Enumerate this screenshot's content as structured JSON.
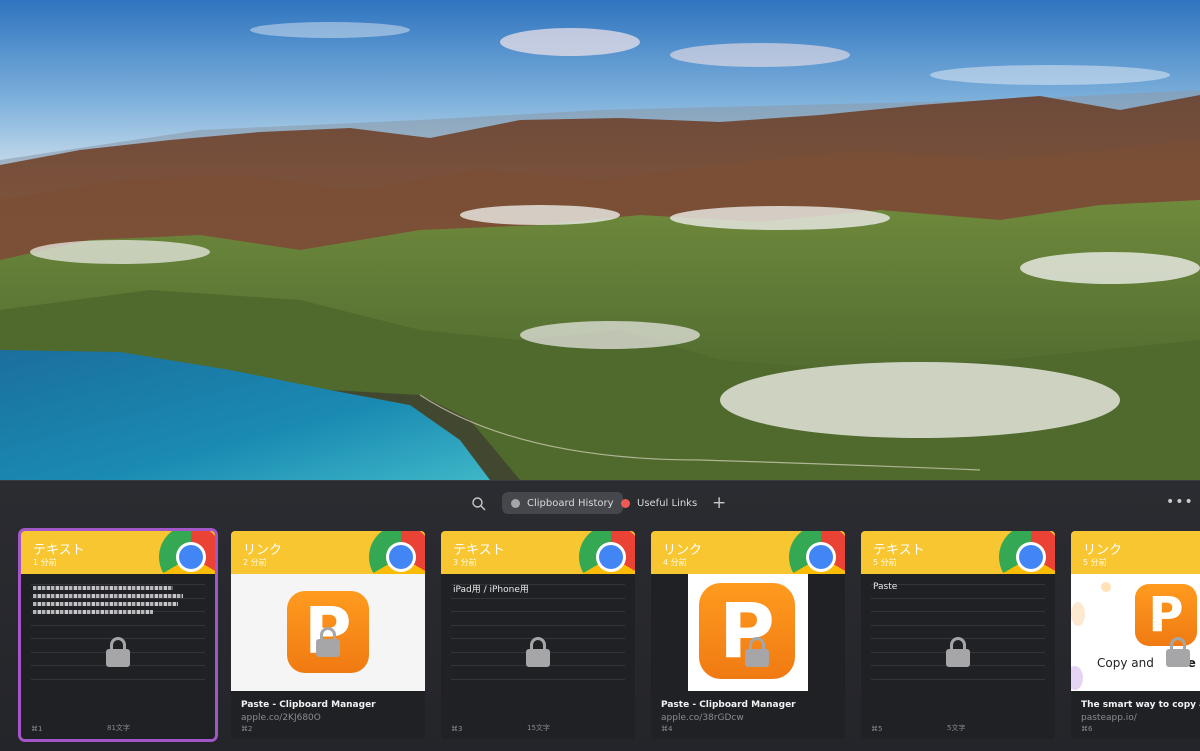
{
  "toolbar": {
    "search_icon": "search-icon",
    "pinboards": [
      {
        "label": "Clipboard History",
        "color": "#a6a6a8",
        "active": true
      },
      {
        "label": "Useful Links",
        "color": "#f05a55",
        "active": false
      }
    ],
    "add_label": "+",
    "more_label": "•••"
  },
  "cards": [
    {
      "type_label": "テキスト",
      "time_label": "1 分前",
      "app_icon": "chrome-icon",
      "hotkey": "⌘1",
      "char_count": "81文字",
      "preview": ""
    },
    {
      "type_label": "リンク",
      "time_label": "2 分前",
      "app_icon": "chrome-icon",
      "hotkey": "⌘2",
      "link_title": "Paste - Clipboard Manager",
      "link_url": "apple.co/2KJ680O"
    },
    {
      "type_label": "テキスト",
      "time_label": "3 分前",
      "app_icon": "chrome-icon",
      "hotkey": "⌘3",
      "char_count": "15文字",
      "preview": "iPad用 / iPhone用"
    },
    {
      "type_label": "リンク",
      "time_label": "4 分前",
      "app_icon": "chrome-icon",
      "hotkey": "⌘4",
      "link_title": "Paste - Clipboard Manager",
      "link_url": "apple.co/38rGDcw"
    },
    {
      "type_label": "テキスト",
      "time_label": "5 分前",
      "app_icon": "chrome-icon",
      "hotkey": "⌘5",
      "char_count": "5文字",
      "preview": "Paste"
    },
    {
      "type_label": "リンク",
      "time_label": "5 分前",
      "app_icon": "chrome-icon",
      "hotkey": "⌘6",
      "link_title": "The smart way to copy and",
      "link_url": "pasteapp.io/",
      "web_text_a": "Copy and ",
      "web_text_b": "e sm"
    }
  ],
  "logo_letter": "P",
  "lock_icon": "lock-icon"
}
